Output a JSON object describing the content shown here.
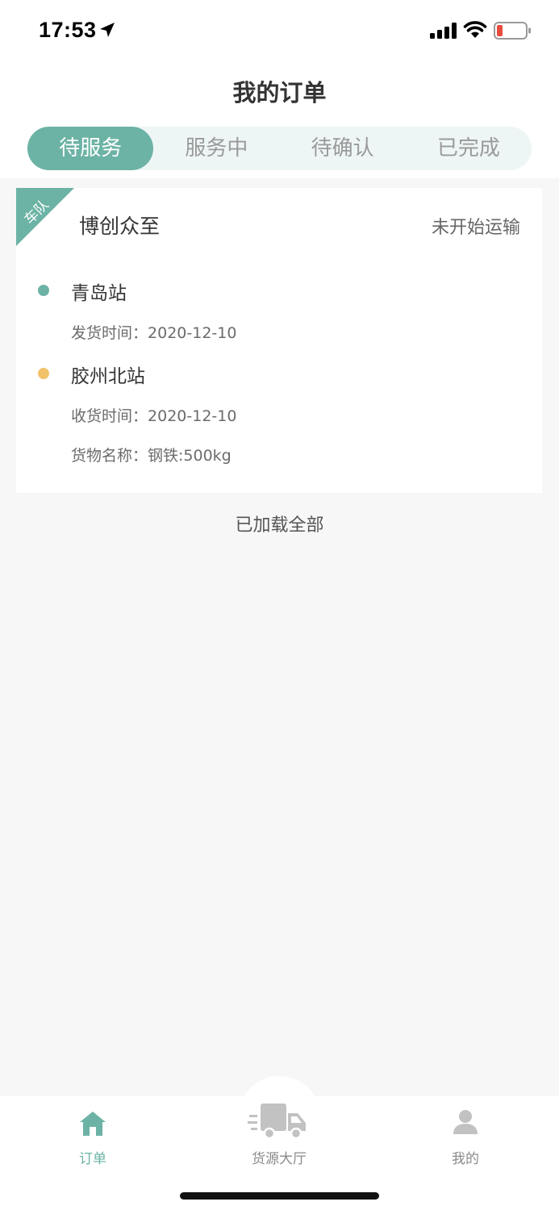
{
  "status_bar": {
    "time": "17:53"
  },
  "header": {
    "title": "我的订单",
    "tabs": [
      {
        "label": "待服务",
        "active": true
      },
      {
        "label": "服务中",
        "active": false
      },
      {
        "label": "待确认",
        "active": false
      },
      {
        "label": "已完成",
        "active": false
      }
    ]
  },
  "order": {
    "corner_tag": "车队",
    "company": "博创众至",
    "status": "未开始运输",
    "origin": {
      "name": "青岛站",
      "time_label": "发货时间：",
      "time": "2020-12-10"
    },
    "destination": {
      "name": "胶州北站",
      "time_label": "收货时间：",
      "time": "2020-12-10"
    },
    "cargo": {
      "label": "货物名称：",
      "value": "钢铁:500kg"
    }
  },
  "list_footer": "已加载全部",
  "tabbar": {
    "items": [
      {
        "label": "订单",
        "icon": "home-icon",
        "active": true
      },
      {
        "label": "货源大厅",
        "icon": "truck-icon",
        "active": false
      },
      {
        "label": "我的",
        "icon": "person-icon",
        "active": false
      }
    ]
  },
  "colors": {
    "accent": "#6cb3a5",
    "origin_dot": "#6cb3a5",
    "destination_dot": "#f2c26b",
    "background": "#f7f7f7"
  }
}
